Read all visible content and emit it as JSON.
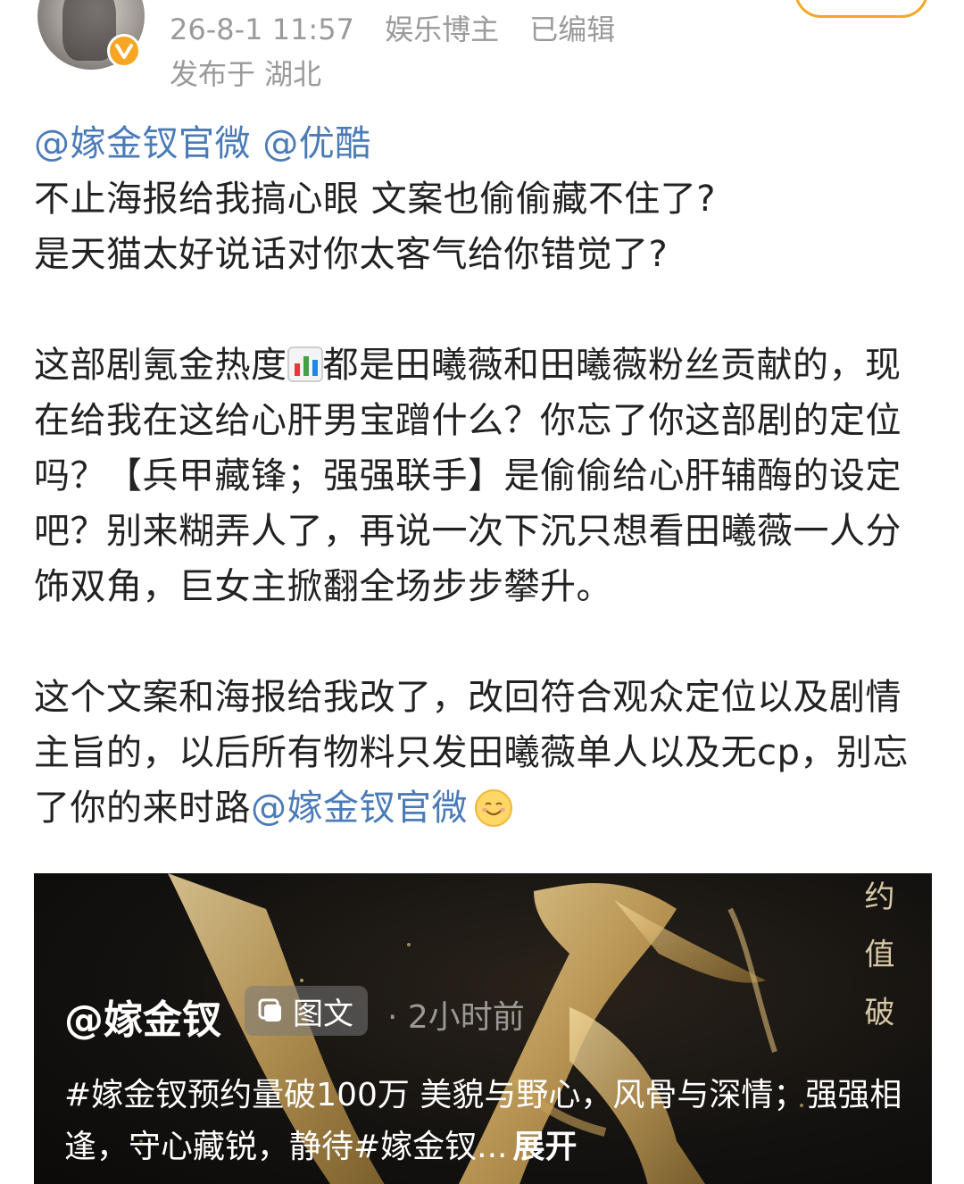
{
  "header": {
    "timestamp": "26-8-1 11:57",
    "author_title": "娱乐博主",
    "edited_label": "已编辑",
    "location": "发布于 湖北"
  },
  "post": {
    "mention1": "@嫁金钗官微",
    "mention2": "@优酷",
    "line1": "不止海报给我搞心眼 文案也偷偷藏不住了?",
    "line2": "是天猫太好说话对你太客气给你错觉了?",
    "para2_part1": "这部剧氪金热度",
    "para2_part2": "都是田曦薇和田曦薇粉丝贡献的，现在给我在这给心肝男宝蹭什么？你忘了你这部剧的定位吗？【兵甲藏锋；强强联手】是偷偷给心肝辅酶的设定吧？别来糊弄人了，再说一次下沉只想看田曦薇一人分饰双角，巨女主掀翻全场步步攀升。",
    "para3_text": "这个文案和海报给我改了，改回符合观众定位以及剧情主旨的，以后所有物料只发田曦薇单人以及无cp，别忘了你的来时路",
    "para3_mention": "@嫁金钗官微"
  },
  "card": {
    "author": "@嫁金钗",
    "tag": "图文",
    "time": "· 2小时前",
    "desc": "#嫁金钗预约量破100万 美貌与野心，风骨与深情；强强相逢，守心藏锐，静待#嫁金钗...",
    "expand": "展开",
    "side_text": "约 值 破"
  },
  "colors": {
    "mention": "#4a7bb7",
    "meta": "#9a9a9a",
    "badge": "#f5a623"
  }
}
